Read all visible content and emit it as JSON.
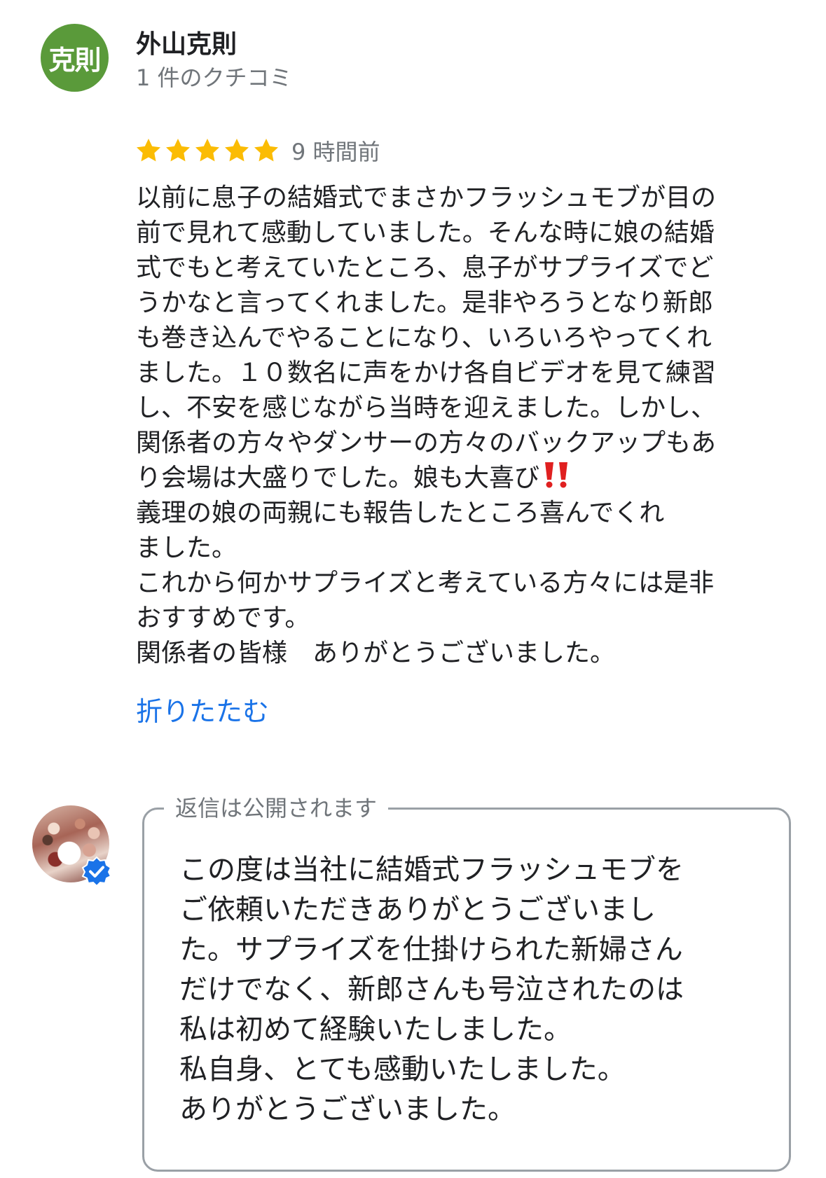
{
  "reviewer": {
    "avatar_text": "克則",
    "avatar_color": "#5a9a3a",
    "name": "外山克則",
    "review_count": "1 件のクチコミ"
  },
  "review": {
    "rating": 5,
    "max_rating": 5,
    "star_color": "#fbbc04",
    "time": "9 時間前",
    "lines": [
      "以前に息子の結婚式でまさかフラッシュモブが目の",
      "前で見れて感動していました。そんな時に娘の結婚",
      "式でもと考えていたところ、息子がサプライズでど",
      "うかなと言ってくれました。是非やろうとなり新郎",
      "も巻き込んでやることになり、いろいろやってくれ",
      "ました。１０数名に声をかけ各自ビデオを見て練習",
      "し、不安を感じながら当時を迎えました。しかし、",
      "関係者の方々やダンサーの方々のバックアップもあ",
      "り会場は大盛りでした。娘も大喜び",
      "義理の娘の両親にも報告したところ喜んでくれ",
      "ました。",
      "これから何かサプライズと考えている方々には是非",
      "おすすめです。",
      "関係者の皆様　ありがとうございました。"
    ],
    "emphasis_icon": "double-exclamation-icon",
    "collapse_label": "折りたたむ"
  },
  "owner_reply": {
    "avatar_icon": "business-photo-avatar",
    "verified_icon": "verified-badge-icon",
    "label": "返信は公開されます",
    "lines": [
      "この度は当社に結婚式フラッシュモブを",
      "ご依頼いただきありがとうございまし",
      "た。サプライズを仕掛けられた新婦さん",
      "だけでなく、新郎さんも号泣されたのは",
      "私は初めて経験いたしました。",
      "私自身、とても感動いたしました。",
      "ありがとうございました。"
    ]
  },
  "colors": {
    "link": "#1a73e8",
    "secondary_text": "#70757a",
    "border": "#9aa0a6",
    "emphasis": "#e02020",
    "verified": "#1a73e8"
  }
}
